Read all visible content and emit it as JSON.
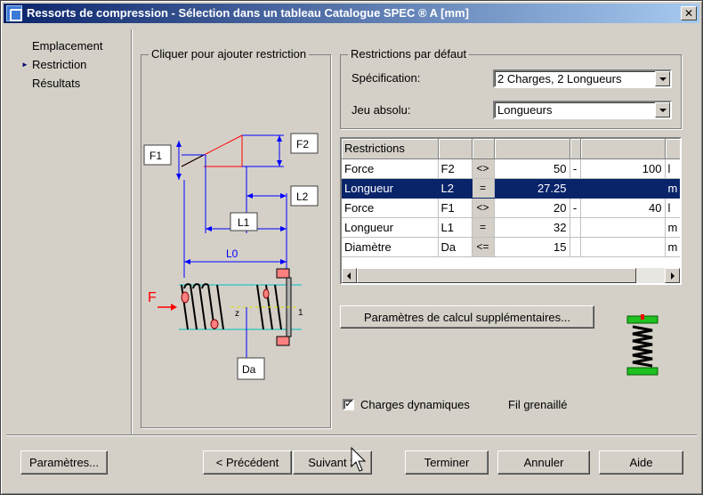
{
  "window": {
    "title": "Ressorts de compression - Sélection dans un tableau Catalogue SPEC ® A [mm]",
    "close": "✕"
  },
  "nav": {
    "items": [
      {
        "label": "Emplacement",
        "active": false
      },
      {
        "label": "Restriction",
        "active": true
      },
      {
        "label": "Résultats",
        "active": false
      }
    ],
    "arrow": "►"
  },
  "diagram": {
    "title": "Cliquer pour ajouter restriction",
    "labels": {
      "f1": "F1",
      "f2": "F2",
      "l1": "L1",
      "l2": "L2",
      "l0": "L0",
      "da": "Da",
      "f": "F",
      "z": "z",
      "one": "1"
    }
  },
  "defaults": {
    "title": "Restrictions par défaut",
    "spec_label": "Spécification:",
    "spec_value": "2 Charges, 2 Longueurs",
    "jeu_label": "Jeu absolu:",
    "jeu_value": "Longueurs"
  },
  "grid": {
    "header": "Restrictions",
    "rows": [
      {
        "name": "Force",
        "sym": "F2",
        "op": "<>",
        "v1": "50",
        "dash": "-",
        "v2": "100",
        "unit": "l"
      },
      {
        "name": "Longueur",
        "sym": "L2",
        "op": "=",
        "v1": "27.25",
        "dash": "",
        "v2": "",
        "unit": "m"
      },
      {
        "name": "Force",
        "sym": "F1",
        "op": "<>",
        "v1": "20",
        "dash": "-",
        "v2": "40",
        "unit": "l"
      },
      {
        "name": "Longueur",
        "sym": "L1",
        "op": "=",
        "v1": "32",
        "dash": "",
        "v2": "",
        "unit": "m"
      },
      {
        "name": "Diamètre",
        "sym": "Da",
        "op": "<=",
        "v1": "15",
        "dash": "",
        "v2": "",
        "unit": "m"
      }
    ]
  },
  "calc_button": "Paramètres de calcul supplémentaires...",
  "options": {
    "dynamic_label": "Charges dynamiques",
    "dynamic_checked": true,
    "wire_label": "Fil grenaillé"
  },
  "buttons": {
    "params": "Paramètres...",
    "prev": "< Précédent",
    "next": "Suivant >",
    "finish": "Terminer",
    "cancel": "Annuler",
    "help": "Aide"
  },
  "colors": {
    "titlebar_start": "#0a246a",
    "titlebar_end": "#a6caf0",
    "dim_blue": "#0000ff",
    "highlight": "#0a246a",
    "ramp_red": "#ff0000"
  }
}
